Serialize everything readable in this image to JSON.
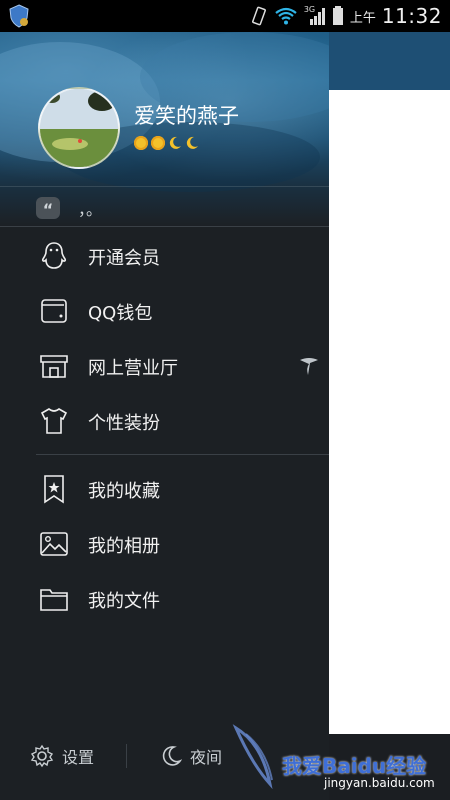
{
  "status_bar": {
    "ampm": "上午",
    "time": "11:32",
    "network": "3G",
    "icons": [
      "shield-app-icon",
      "vibrate-icon",
      "wifi-icon",
      "signal-icon",
      "battery-icon"
    ]
  },
  "profile": {
    "username": "爱笑的燕子",
    "level_icons": [
      "sun",
      "sun",
      "moon",
      "moon"
    ],
    "signature_badge": "“",
    "signature": "，。"
  },
  "menu": {
    "items": [
      {
        "label": "开通会员",
        "icon": "penguin-icon"
      },
      {
        "label": "QQ钱包",
        "icon": "wallet-icon"
      },
      {
        "label": "网上营业厅",
        "icon": "store-icon",
        "badge_icon": "telecom-icon"
      },
      {
        "label": "个性装扮",
        "icon": "tshirt-icon"
      },
      {
        "label": "我的收藏",
        "icon": "bookmark-star-icon"
      },
      {
        "label": "我的相册",
        "icon": "photo-album-icon"
      },
      {
        "label": "我的文件",
        "icon": "folder-icon"
      }
    ]
  },
  "bottom_bar": {
    "settings_label": "设置",
    "night_label": "夜间"
  },
  "watermark": {
    "text": "我爱Baidu经验",
    "url": "jingyan.baidu.com"
  }
}
